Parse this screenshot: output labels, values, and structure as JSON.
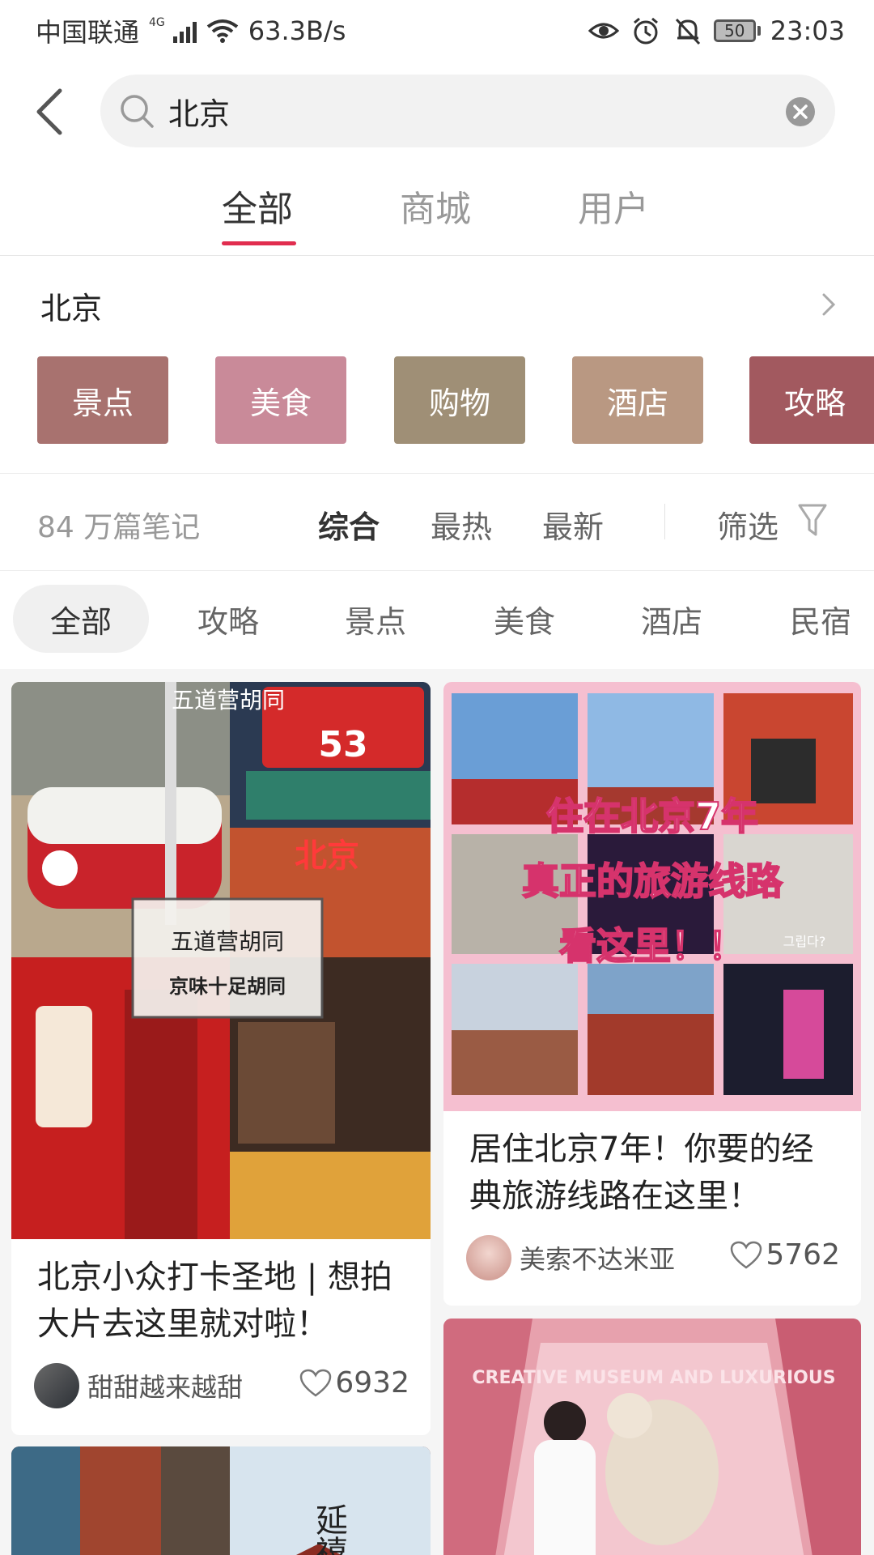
{
  "status_bar": {
    "carrier": "中国联通",
    "network_type": "4G",
    "speed": "63.3B/s",
    "battery": "50",
    "time": "23:03"
  },
  "search": {
    "value": "北京"
  },
  "tabs": [
    {
      "label": "全部",
      "active": true
    },
    {
      "label": "商城",
      "active": false
    },
    {
      "label": "用户",
      "active": false
    }
  ],
  "location": {
    "title": "北京",
    "categories": [
      {
        "label": "景点",
        "color": "#a8726f"
      },
      {
        "label": "美食",
        "color": "#c98a99"
      },
      {
        "label": "购物",
        "color": "#9f8f76"
      },
      {
        "label": "酒店",
        "color": "#b99882"
      },
      {
        "label": "攻略",
        "color": "#a2595f"
      }
    ]
  },
  "sort": {
    "count": "84 万篇笔记",
    "options": [
      {
        "label": "综合",
        "active": true
      },
      {
        "label": "最热",
        "active": false
      },
      {
        "label": "最新",
        "active": false
      }
    ],
    "filter_label": "筛选"
  },
  "chips": [
    {
      "label": "全部",
      "active": true
    },
    {
      "label": "攻略",
      "active": false
    },
    {
      "label": "景点",
      "active": false
    },
    {
      "label": "美食",
      "active": false
    },
    {
      "label": "酒店",
      "active": false
    },
    {
      "label": "民宿",
      "active": false
    }
  ],
  "feed": {
    "card1": {
      "title_line1": "北京小众打卡圣地 | 想拍",
      "title_line2": "大片去这里就对啦！",
      "author": "甜甜越来越甜",
      "likes": "6932",
      "image_text": {
        "sign_top": "五道营胡同",
        "sign_num": "53",
        "box_line1": "五道营胡同",
        "box_line2": "京味十足胡同",
        "neon": "北京"
      }
    },
    "card2": {
      "title_line1": "居住北京7年！你要的经",
      "title_line2": "典旅游线路在这里！",
      "author": "美索不达米亚",
      "likes": "5762",
      "image_text": {
        "line1": "住在北京7年",
        "line2": "真正的旅游线路",
        "line3": "看这里！！",
        "sticker": "그립다?"
      }
    },
    "card3": {
      "image_text": {
        "vertical": "延禧"
      }
    },
    "card4": {
      "image_text": {
        "stairs": "CREATIVE MUSEUM AND LUXURIOUS"
      }
    }
  }
}
